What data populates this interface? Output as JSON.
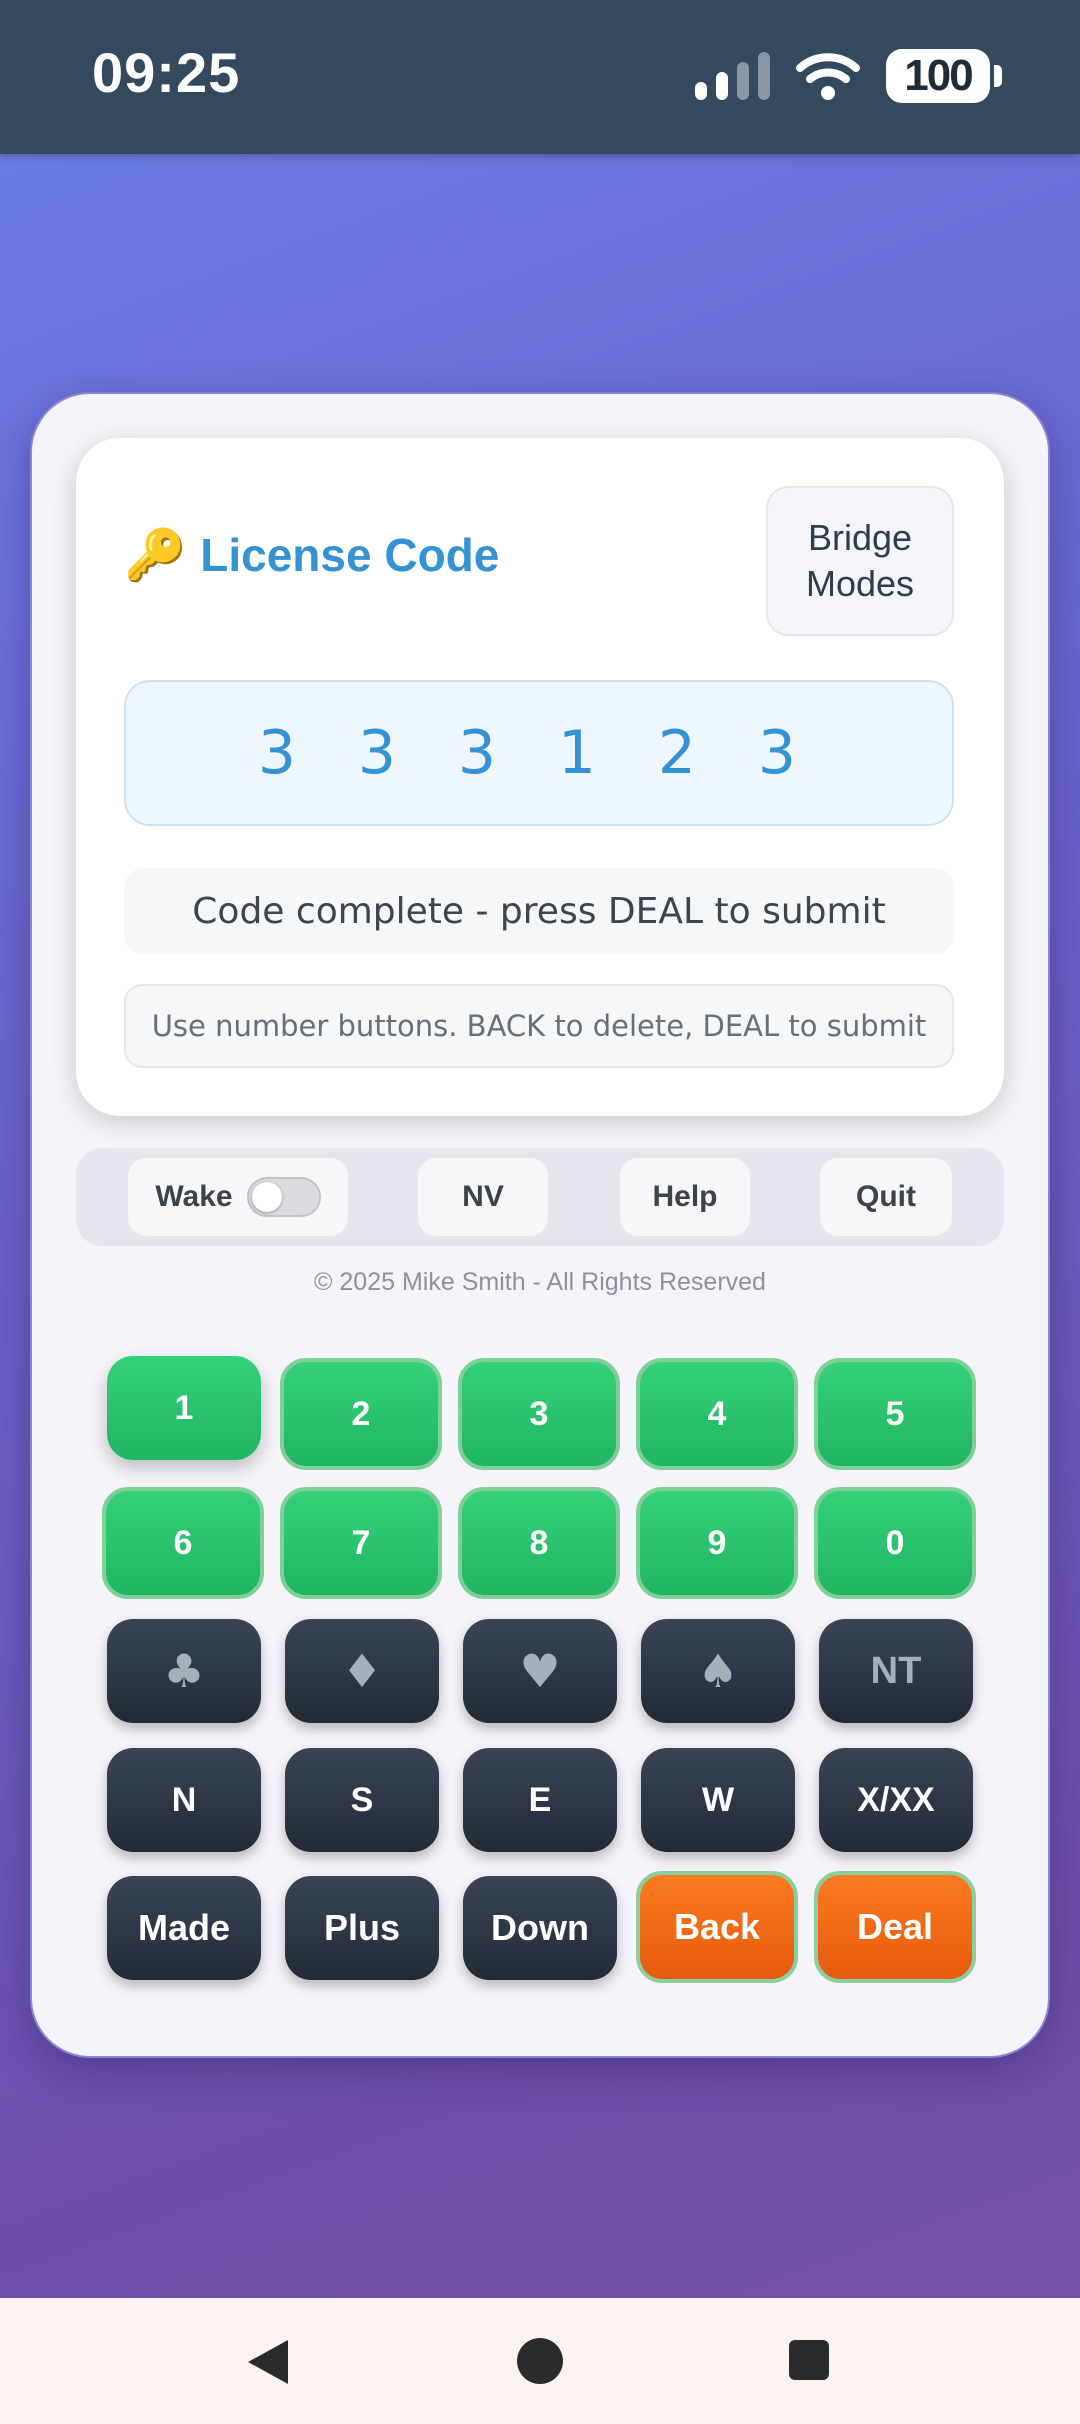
{
  "status_bar": {
    "time": "09:25",
    "battery": "100",
    "signal_icon": "signal-bars-icon",
    "wifi_icon": "wifi-icon"
  },
  "license": {
    "icon": "🔑",
    "title": "License Code",
    "modes_button_line1": "Bridge",
    "modes_button_line2": "Modes",
    "code_digits": [
      "3",
      "3",
      "3",
      "1",
      "2",
      "3"
    ],
    "status_message": "Code complete - press DEAL to submit",
    "hint": "Use number buttons. BACK to delete, DEAL to submit"
  },
  "toolbar": {
    "wake_label": "Wake",
    "wake_on": false,
    "nv_label": "NV",
    "help_label": "Help",
    "quit_label": "Quit"
  },
  "copyright": "© 2025 Mike Smith - All Rights Reserved",
  "keypad": {
    "row1": [
      "1",
      "2",
      "3",
      "4",
      "5"
    ],
    "row2": [
      "6",
      "7",
      "8",
      "9",
      "0"
    ],
    "suits": {
      "clubs": "♣",
      "diamonds": "♦",
      "hearts": "♥",
      "spades": "♠",
      "nt": "NT"
    },
    "row4": [
      "N",
      "S",
      "E",
      "W",
      "X/XX"
    ],
    "row5": [
      "Made",
      "Plus",
      "Down",
      "Back",
      "Deal"
    ]
  },
  "colors": {
    "number_key": "#2ecc71",
    "dark_key": "#2c3e50",
    "action_key": "#f97316",
    "accent": "#3592d5"
  }
}
